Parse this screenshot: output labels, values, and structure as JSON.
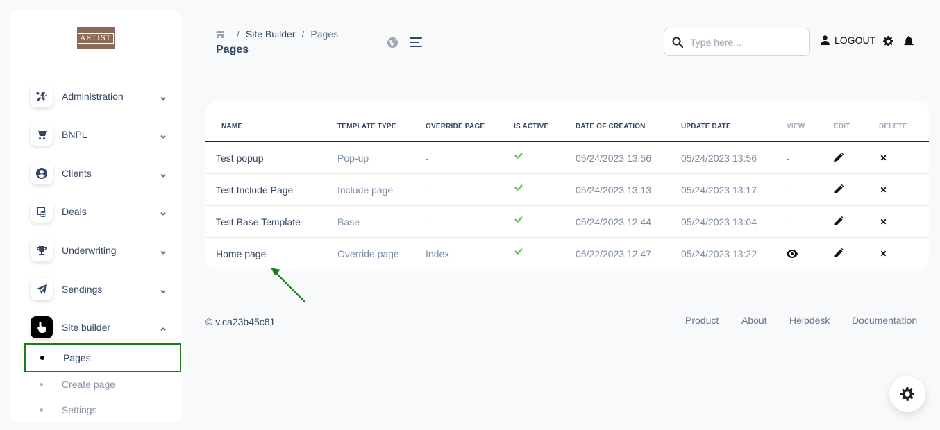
{
  "sidebar": {
    "logo_text": "ARTIST",
    "items": [
      {
        "label": "Administration",
        "icon": "tools-icon"
      },
      {
        "label": "BNPL",
        "icon": "cart-icon"
      },
      {
        "label": "Clients",
        "icon": "user-circle-icon"
      },
      {
        "label": "Deals",
        "icon": "deals-icon"
      },
      {
        "label": "Underwriting",
        "icon": "trophy-icon"
      },
      {
        "label": "Sendings",
        "icon": "paper-plane-icon"
      },
      {
        "label": "Site builder",
        "icon": "pointer-hand-icon"
      }
    ],
    "sub_items": [
      {
        "label": "Pages"
      },
      {
        "label": "Create page"
      },
      {
        "label": "Settings"
      }
    ]
  },
  "header": {
    "breadcrumb": [
      "Site Builder",
      "Pages"
    ],
    "title": "Pages",
    "search_placeholder": "Type here...",
    "logout_label": "LOGOUT"
  },
  "table": {
    "columns": [
      "Name",
      "Template type",
      "Override page",
      "Is active",
      "Date of creation",
      "Update date",
      "View",
      "Edit",
      "Delete"
    ],
    "rows": [
      {
        "name": "Test popup",
        "template_type": "Pop-up",
        "override_page": "-",
        "created": "05/24/2023 13:56",
        "updated": "05/24/2023 13:56",
        "view": "-"
      },
      {
        "name": "Test Include Page",
        "template_type": "Include page",
        "override_page": "-",
        "created": "05/24/2023 13:13",
        "updated": "05/24/2023 13:17",
        "view": "-"
      },
      {
        "name": "Test Base Template",
        "template_type": "Base",
        "override_page": "-",
        "created": "05/24/2023 12:44",
        "updated": "05/24/2023 13:04",
        "view": "-"
      },
      {
        "name": "Home page",
        "template_type": "Override page",
        "override_page": "Index",
        "created": "05/22/2023 12:47",
        "updated": "05/24/2023 13:22",
        "view": ""
      }
    ]
  },
  "footer": {
    "version": "© v.ca23b45c81",
    "links": [
      "Product",
      "About",
      "Helpdesk",
      "Documentation"
    ]
  },
  "colors": {
    "highlight_box": "#1a7f1a",
    "active_check": "#67c23a",
    "arrow": "#1a7f1a"
  }
}
